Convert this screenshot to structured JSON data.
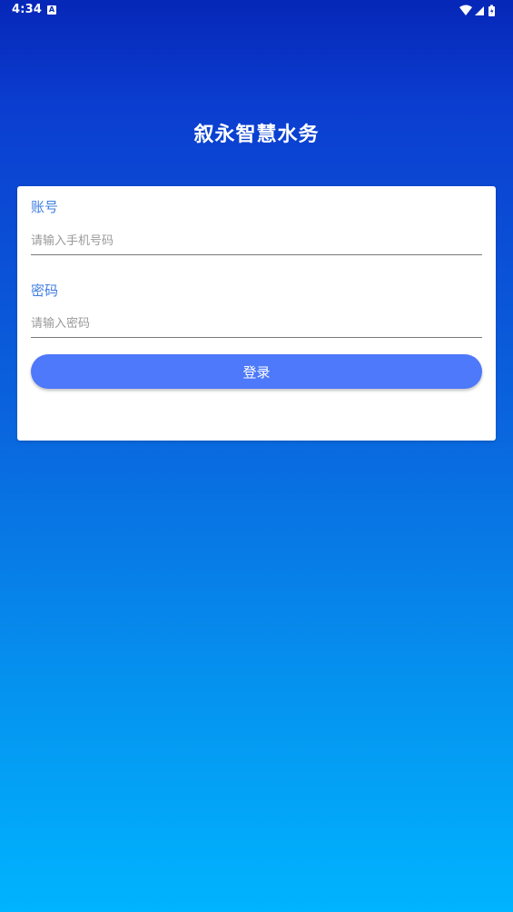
{
  "status_bar": {
    "time": "4:34",
    "notification_icon": "a-icon",
    "icons": [
      "wifi-icon",
      "signal-icon",
      "battery-icon"
    ]
  },
  "app": {
    "title": "叙永智慧水务"
  },
  "login_form": {
    "account_label": "账号",
    "account_placeholder": "请输入手机号码",
    "account_value": "",
    "password_label": "密码",
    "password_placeholder": "请输入密码",
    "password_value": "",
    "login_button_label": "登录"
  },
  "colors": {
    "gradient_top": "#0627b8",
    "gradient_bottom": "#00b4ff",
    "label_color": "#3f7ee0",
    "button_color": "#4d79fa"
  }
}
